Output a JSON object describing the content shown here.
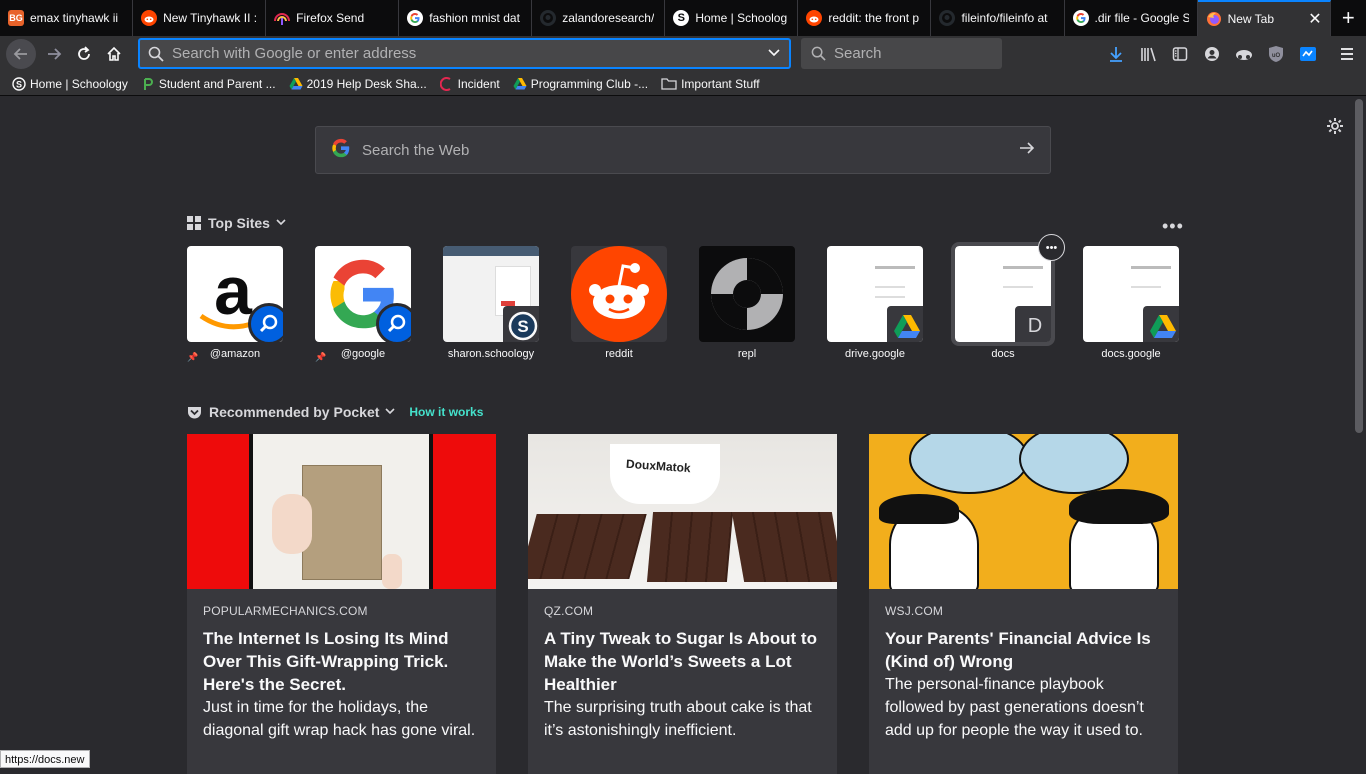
{
  "tabs": [
    {
      "label": "emax tinyhawk ii",
      "icon": "bg-icon",
      "fav_text": "BG",
      "fav_color": "#e8632a"
    },
    {
      "label": "New Tinyhawk II :",
      "icon": "reddit-icon",
      "fav_color": "#ff4500"
    },
    {
      "label": "Firefox Send",
      "icon": "firefox-send-icon",
      "fav_color": "#e22850"
    },
    {
      "label": "fashion mnist dat",
      "icon": "google-icon",
      "fav_color": "#ffffff"
    },
    {
      "label": "zalandoresearch/",
      "icon": "github-icon",
      "fav_color": "#24292e"
    },
    {
      "label": "Home | Schoolog",
      "icon": "schoology-icon",
      "fav_color": "#ffffff"
    },
    {
      "label": "reddit: the front p",
      "icon": "reddit-icon",
      "fav_color": "#ff4500"
    },
    {
      "label": "fileinfo/fileinfo at",
      "icon": "github-icon",
      "fav_color": "#24292e"
    },
    {
      "label": ".dir file - Google S",
      "icon": "google-icon",
      "fav_color": "#ffffff"
    },
    {
      "label": "New Tab",
      "icon": "firefox-icon",
      "fav_color": "#ff7139",
      "active": true
    }
  ],
  "toolbar": {
    "url_placeholder": "Search with Google or enter address",
    "search_placeholder": "Search"
  },
  "bookmarks": [
    {
      "label": "Home | Schoology",
      "icon": "schoology-icon"
    },
    {
      "label": "Student and Parent ...",
      "icon": "p-icon"
    },
    {
      "label": "2019 Help Desk Sha...",
      "icon": "google-drive-icon"
    },
    {
      "label": "Incident",
      "icon": "servicenow-icon"
    },
    {
      "label": "Programming Club -...",
      "icon": "google-drive-icon"
    },
    {
      "label": "Important Stuff",
      "icon": "folder-icon"
    }
  ],
  "newtab": {
    "web_search_placeholder": "Search the Web",
    "top_sites_title": "Top Sites",
    "pocket_title": "Recommended by Pocket",
    "pocket_link": "How it works"
  },
  "top_sites": [
    {
      "label": "@amazon",
      "icon": "amazon-icon"
    },
    {
      "label": "@google",
      "icon": "google-icon"
    },
    {
      "label": "sharon.schoology",
      "icon": "schoology-icon"
    },
    {
      "label": "reddit",
      "icon": "reddit-icon"
    },
    {
      "label": "repl",
      "icon": "repl-icon"
    },
    {
      "label": "drive.google",
      "icon": "google-drive-icon"
    },
    {
      "label": "docs",
      "icon": "letter-d-icon",
      "letter": "D"
    },
    {
      "label": "docs.google",
      "icon": "google-drive-icon"
    }
  ],
  "pocket_cards": [
    {
      "source": "POPULARMECHANICS.COM",
      "title": "The Internet Is Losing Its Mind Over This Gift-Wrapping Trick. Here's the Secret.",
      "excerpt": "Just in time for the holidays, the diagonal gift wrap hack has gone viral."
    },
    {
      "source": "QZ.COM",
      "title": "A Tiny Tweak to Sugar Is About to Make the World’s Sweets a Lot Healthier",
      "excerpt": "The surprising truth about cake is that it’s astonishingly inefficient.",
      "image_text": "DouxMatok"
    },
    {
      "source": "WSJ.COM",
      "title": "Your Parents' Financial Advice Is (Kind of) Wrong",
      "excerpt": "The personal-finance playbook followed by past generations doesn’t add up for people the way it used to."
    }
  ],
  "status_url": "https://docs.new",
  "colors": {
    "accent": "#0a84ff",
    "link": "#45a1ff",
    "background": "#2a2a2e",
    "reddit": "#ff4500"
  }
}
